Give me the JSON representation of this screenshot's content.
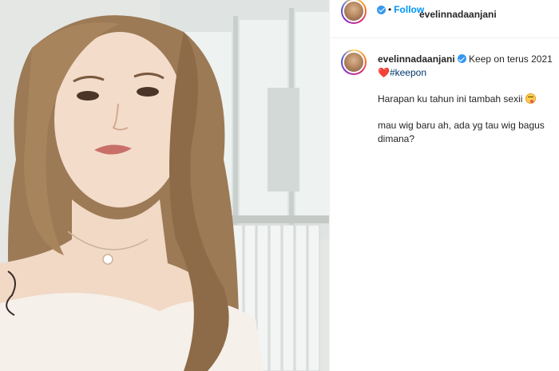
{
  "post": {
    "author": {
      "username": "evelinnadaanjani",
      "verified": true
    },
    "header": {
      "separator": "•",
      "follow_label": "Follow"
    },
    "caption": {
      "line1": "Keep on terus 2021",
      "heart": "❤️",
      "hashtag": "#keepon",
      "paragraph2": "Harapan ku tahun ini tambah sexii",
      "emoji": "😋",
      "paragraph3": "mau wig baru ah, ada yg tau wig bagus dimana?"
    }
  },
  "colors": {
    "link_blue": "#0095f6",
    "verified_blue": "#3897f0",
    "hashtag": "#00376b",
    "text": "#262626",
    "border": "#efefef"
  },
  "icons": [
    "verified-badge-icon",
    "heart-emoji-icon",
    "yum-emoji-icon"
  ]
}
